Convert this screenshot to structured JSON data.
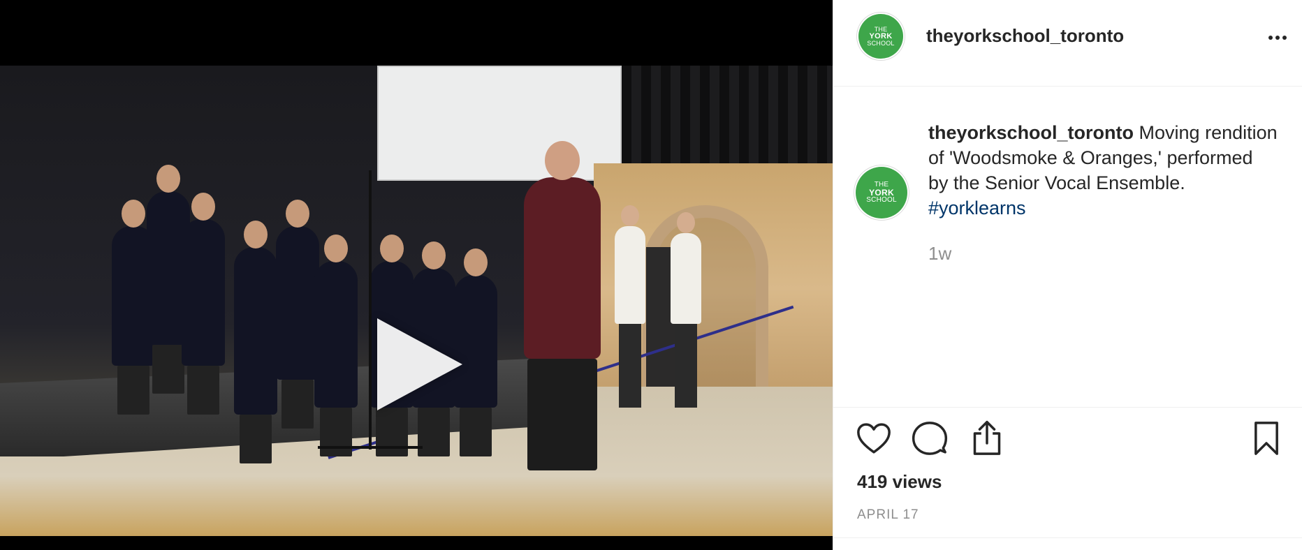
{
  "post": {
    "username": "theyorkschool_toronto",
    "avatar": {
      "line1": "THE",
      "line2": "YORK",
      "line3": "SCHOOL",
      "color": "#3ea64a"
    },
    "caption": {
      "username": "theyorkschool_toronto",
      "text": " Moving rendition of 'Woodsmoke & Oranges,' performed by the Senior Vocal Ensemble. ",
      "hashtag": "#yorklearns",
      "hashtag_color": "#003569"
    },
    "time_ago": "1w",
    "views": "419 views",
    "date": "APRIL 17"
  },
  "icons": {
    "more": "more-options-icon",
    "like": "heart-icon",
    "comment": "comment-icon",
    "share": "share-icon",
    "save": "bookmark-icon",
    "play": "play-icon"
  },
  "theme": {
    "text": "#262626",
    "secondary": "#8e8e8e",
    "border": "#efefef"
  }
}
